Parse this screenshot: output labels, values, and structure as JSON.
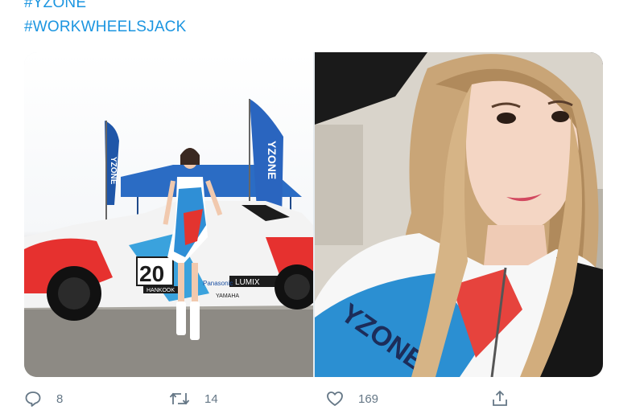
{
  "hashtags": [
    "#YZONE",
    "#WORKWHEELSJACK"
  ],
  "photos": {
    "left": {
      "flag_left_text": "YZONE",
      "flag_right_text": "YZONE",
      "car_number": "20",
      "sponsor_1": "LUMIX",
      "sponsor_2": "Panasonic",
      "sponsor_3": "HANKOOK",
      "sponsor_4": "YAMAHA"
    },
    "right": {
      "jacket_text": "YZONE"
    }
  },
  "actions": {
    "reply_count": "8",
    "retweet_count": "14",
    "like_count": "169"
  },
  "colors": {
    "hashtag": "#1b95e0",
    "action": "#657786"
  }
}
